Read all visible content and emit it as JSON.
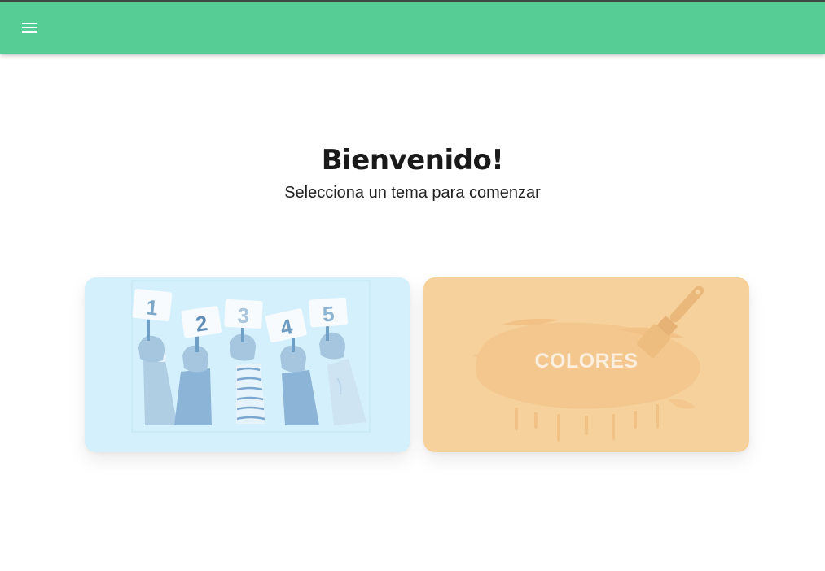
{
  "topbar": {
    "color": "#57cd96",
    "menu_icon": "hamburger-menu-icon"
  },
  "hero": {
    "title": "Bienvenido!",
    "subtitle": "Selecciona un tema para comenzar"
  },
  "topics": [
    {
      "id": "numbers",
      "image": "hands-holding-number-cards",
      "card_numbers": [
        "1",
        "2",
        "3",
        "4",
        "5"
      ],
      "background": "#d3f0fc"
    },
    {
      "id": "colors",
      "image": "paint-brush-stroke",
      "label": "COLORES",
      "background": "#f6d19b"
    }
  ]
}
